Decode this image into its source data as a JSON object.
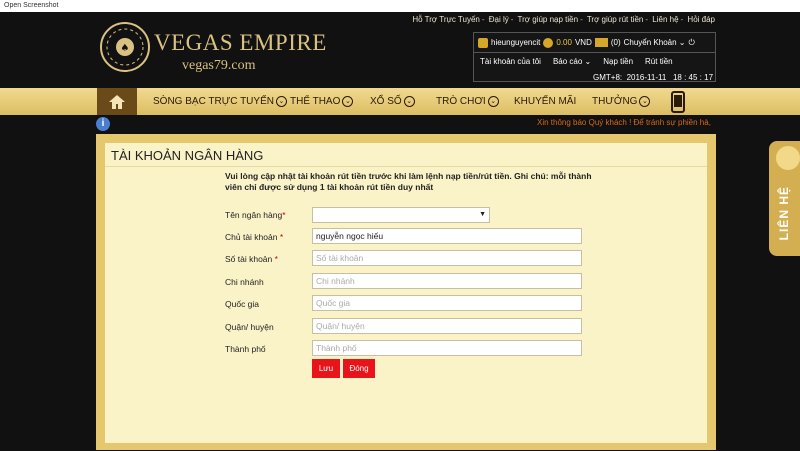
{
  "window": {
    "title": "Open Screenshot"
  },
  "top_links": [
    "Hỗ Trợ Trực Tuyến",
    "Đại lý",
    "Trợ giúp nạp tiền",
    "Trợ giúp rút tiền",
    "Liên hệ",
    "Hỏi đáp"
  ],
  "logo": {
    "name": "VEGAS EMPIRE",
    "domain": "vegas79.com"
  },
  "account": {
    "username": "hieunguyencit",
    "balance": "0.00",
    "currency": "VND",
    "messages": "(0)",
    "transfer": "Chuyển Khoản",
    "menu": [
      "Tài khoản của tôi",
      "Báo cáo",
      "Nạp tiền",
      "Rút tiền"
    ]
  },
  "clock": {
    "zone": "GMT+8:",
    "date": "2016-11-11",
    "time": "18 : 45 : 17"
  },
  "nav": {
    "items": [
      "SÒNG BẠC TRỰC TUYẾN",
      "THỂ THAO",
      "XỔ SỐ",
      "TRÒ CHƠI",
      "KHUYẾN MÃI",
      "THƯỞNG"
    ]
  },
  "notice": "Xin thông báo Quý khách ! Để tránh sự phiền hà,",
  "form": {
    "title": "TÀI KHOẢN NGÂN HÀNG",
    "note": "Vui lòng cập nhật tài khoản rút tiền trước khi làm lệnh nạp tiền/rút tiền. Ghi chú: mỗi thành viên chỉ được sử dụng 1 tài khoản rút tiền duy nhất",
    "fields": [
      {
        "label": "Tên ngân hàng",
        "required": "*",
        "value": "",
        "placeholder": ""
      },
      {
        "label": "Chủ tài khoản ",
        "required": "*",
        "value": "nguyễn ngọc hiếu",
        "placeholder": ""
      },
      {
        "label": "Số tài khoản ",
        "required": "*",
        "value": "",
        "placeholder": "Số tài khoản"
      },
      {
        "label": "Chi nhánh",
        "required": "",
        "value": "",
        "placeholder": "Chi nhánh"
      },
      {
        "label": "Quốc gia",
        "required": "",
        "value": "",
        "placeholder": "Quốc gia"
      },
      {
        "label": "Quận/ huyện",
        "required": "",
        "value": "",
        "placeholder": "Quận/ huyện"
      },
      {
        "label": "Thành phố",
        "required": "",
        "value": "",
        "placeholder": "Thành phố"
      }
    ],
    "save_label": "Lưu",
    "close_label": "Đóng"
  },
  "contact_tab": "LIÊN HỆ",
  "colors": {
    "gold": "#d9c182",
    "nav": "#e5c86e",
    "button": "#e8141a",
    "form_bg": "#fbf3c8"
  },
  "icons": [
    "home-icon",
    "info-icon",
    "mobile-icon",
    "user-icon",
    "coin-icon",
    "mail-icon",
    "power-icon",
    "chevron-down-icon",
    "support-agent-icon"
  ]
}
